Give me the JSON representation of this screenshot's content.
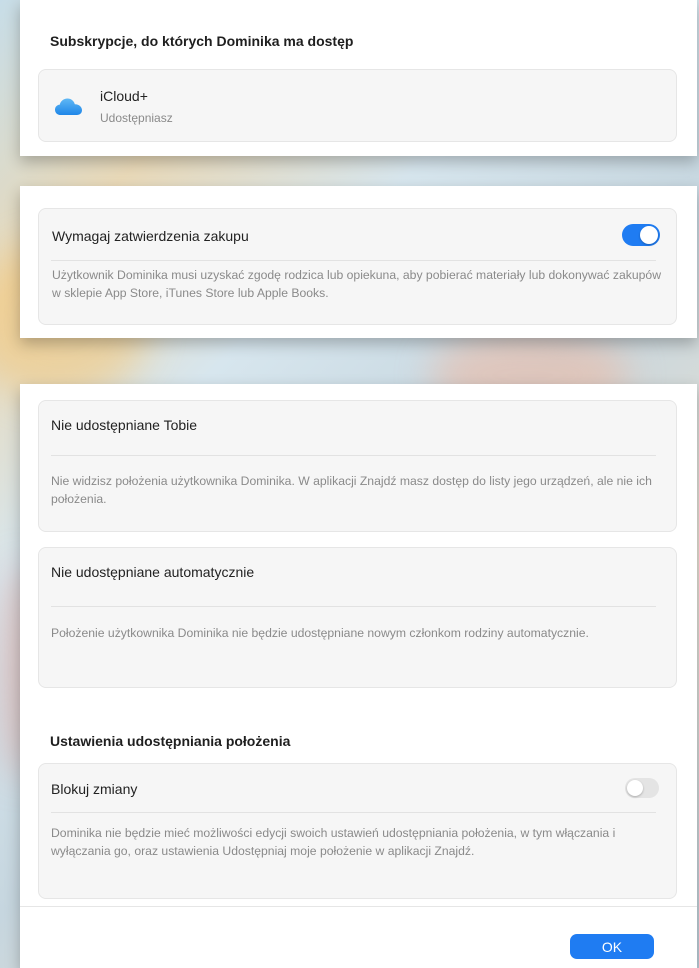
{
  "subscriptions": {
    "heading": "Subskrypcje, do których Dominika ma dostęp",
    "item": {
      "icon": "icloud-icon",
      "name": "iCloud+",
      "status": "Udostępniasz"
    }
  },
  "purchase": {
    "label": "Wymagaj zatwierdzenia zakupu",
    "toggle_on": true,
    "description": "Użytkownik Dominika musi uzyskać zgodę rodzica lub opiekuna, aby pobierać materiały lub dokonywać zakupów w sklepie App Store, iTunes Store lub Apple Books."
  },
  "location": {
    "not_shared_title": "Nie udostępniane Tobie",
    "not_shared_desc": "Nie widzisz położenia użytkownika Dominika. W aplikacji Znajdź masz dostęp do listy jego urządzeń, ale nie ich położenia.",
    "not_auto_title": "Nie udostępniane automatycznie",
    "not_auto_desc": "Położenie użytkownika Dominika nie będzie udostępniane nowym członkom rodziny automatycznie.",
    "settings_heading": "Ustawienia udostępniania położenia",
    "lock_label": "Blokuj zmiany",
    "lock_toggle_on": false,
    "lock_desc": "Dominika nie będzie mieć możliwości edycji swoich ustawień udostępniania położenia, w tym włączania i wyłączania go, oraz ustawienia Udostępniaj moje położenie w aplikacji Znajdź."
  },
  "footer": {
    "ok_label": "OK"
  },
  "colors": {
    "accent": "#1f7cf2",
    "toggle_off": "#e4e4e4"
  }
}
